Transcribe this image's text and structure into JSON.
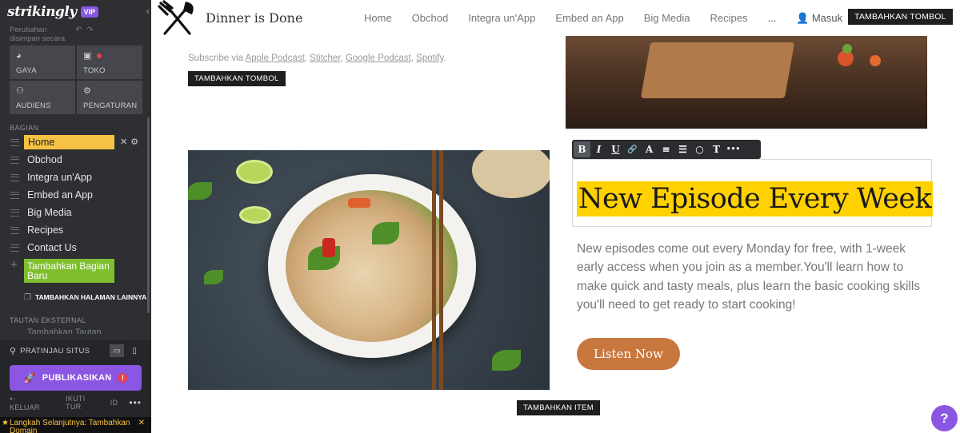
{
  "sidebar": {
    "logo": "strikingly",
    "vip": "VIP",
    "autosave": "Perubahan disimpan secara otomatis.",
    "tiles": [
      {
        "label": "GAYA",
        "icon": "palette-icon"
      },
      {
        "label": "TOKO",
        "icon": "shopping-bag-icon"
      },
      {
        "label": "AUDIENS",
        "icon": "people-icon"
      },
      {
        "label": "PENGATURAN",
        "icon": "gear-icon"
      }
    ],
    "sections_title": "BAGIAN",
    "items": [
      {
        "label": "Home"
      },
      {
        "label": "Obchod"
      },
      {
        "label": "Integra un'App"
      },
      {
        "label": "Embed an App"
      },
      {
        "label": "Big Media"
      },
      {
        "label": "Recipes"
      },
      {
        "label": "Contact Us"
      }
    ],
    "add_section": "Tambahkan Bagian Baru",
    "more_pages": "TAMBAHKAN HALAMAN LAINNYA",
    "external_title": "TAUTAN EKSTERNAL",
    "external_item": "Tambahkan Tautan",
    "preview_label": "PRATINJAU SITUS",
    "publish": "PUBLIKASIKAN",
    "publish_alert": "!",
    "footer": {
      "exit": "KELUAR",
      "tour": "IKUTI TUR",
      "lang": "ID",
      "more": "•••"
    },
    "next_step": "Langkah Selanjutnya: Tambahkan Domain"
  },
  "header": {
    "site_title": "Dinner is Done",
    "menu": [
      "Home",
      "Obchod",
      "Integra un'App",
      "Embed an App",
      "Big Media",
      "Recipes",
      "..."
    ],
    "login": "Masuk",
    "add_button": "TAMBAHKAN TOMBOL"
  },
  "content": {
    "subscribe_prefix": "Subscribe via ",
    "podcasts": [
      "Apple Podcast",
      "Stitcher",
      "Google Podcast",
      "Spotify"
    ],
    "subscribe_suffix": ".",
    "add_button": "TAMBAHKAN TOMBOL",
    "headline": "New Episode Every Week",
    "description": "New episodes come out every Monday for free, with 1-week early access when you join as a member.You'll learn how to make quick and tasty meals, plus learn the basic cooking skills you'll need to get ready to start cooking!",
    "listen_button": "Listen Now",
    "add_item": "TAMBAHKAN ITEM",
    "help": "?"
  },
  "toolbar": {
    "tools": [
      "B",
      "I",
      "U",
      "🔗",
      "A",
      "≡",
      "☰",
      "○",
      "T",
      "•••"
    ]
  },
  "colors": {
    "sidebar_bg": "#2e2f33",
    "accent_purple": "#8a56e2",
    "active_yellow": "#f6c244",
    "add_green": "#7fbf2e",
    "highlight": "#ffd100",
    "listen_button": "#c8773e"
  }
}
